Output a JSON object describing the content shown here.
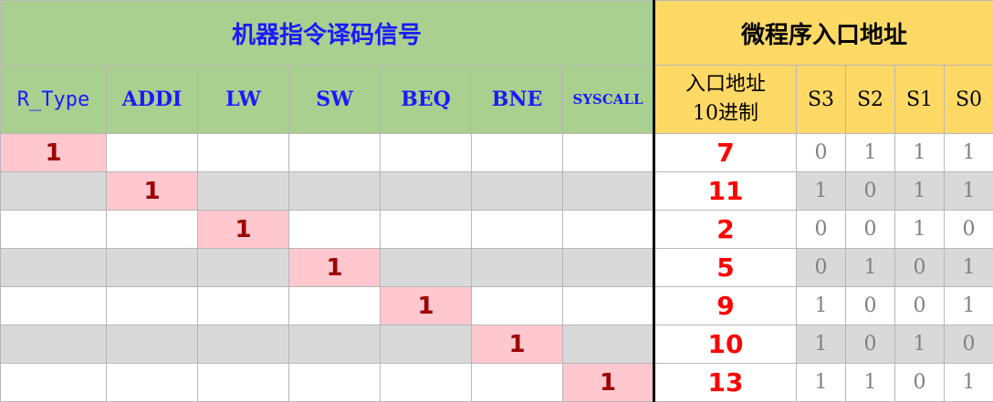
{
  "titles": {
    "machine_signals": "机器指令译码信号",
    "micro_entry": "微程序入口地址"
  },
  "signal_headers": [
    "R_Type",
    "ADDI",
    "LW",
    "SW",
    "BEQ",
    "BNE",
    "SYSCALL"
  ],
  "addr_header": {
    "line1": "入口地址",
    "line2": "10进制"
  },
  "state_headers": [
    "S3",
    "S2",
    "S1",
    "S0"
  ],
  "rows": [
    {
      "signals": [
        "1",
        "",
        "",
        "",
        "",
        "",
        ""
      ],
      "entry": "7",
      "bits": [
        "0",
        "1",
        "1",
        "1"
      ],
      "shaded": false
    },
    {
      "signals": [
        "",
        "1",
        "",
        "",
        "",
        "",
        ""
      ],
      "entry": "11",
      "bits": [
        "1",
        "0",
        "1",
        "1"
      ],
      "shaded": true
    },
    {
      "signals": [
        "",
        "",
        "1",
        "",
        "",
        "",
        ""
      ],
      "entry": "2",
      "bits": [
        "0",
        "0",
        "1",
        "0"
      ],
      "shaded": false
    },
    {
      "signals": [
        "",
        "",
        "",
        "1",
        "",
        "",
        ""
      ],
      "entry": "5",
      "bits": [
        "0",
        "1",
        "0",
        "1"
      ],
      "shaded": true
    },
    {
      "signals": [
        "",
        "",
        "",
        "",
        "1",
        "",
        ""
      ],
      "entry": "9",
      "bits": [
        "1",
        "0",
        "0",
        "1"
      ],
      "shaded": false
    },
    {
      "signals": [
        "",
        "",
        "",
        "",
        "",
        "1",
        ""
      ],
      "entry": "10",
      "bits": [
        "1",
        "0",
        "1",
        "0"
      ],
      "shaded": true
    },
    {
      "signals": [
        "",
        "",
        "",
        "",
        "",
        "",
        "1"
      ],
      "entry": "13",
      "bits": [
        "1",
        "1",
        "0",
        "1"
      ],
      "shaded": false
    }
  ],
  "colors": {
    "header_green": "#a9d08e",
    "header_yellow": "#ffd966",
    "hit_fill": "#ffc7ce",
    "hit_text": "#9c0006",
    "entry_text": "#ff0000",
    "row_shade": "#d9d9d9",
    "signal_text": "#1a1aff"
  }
}
